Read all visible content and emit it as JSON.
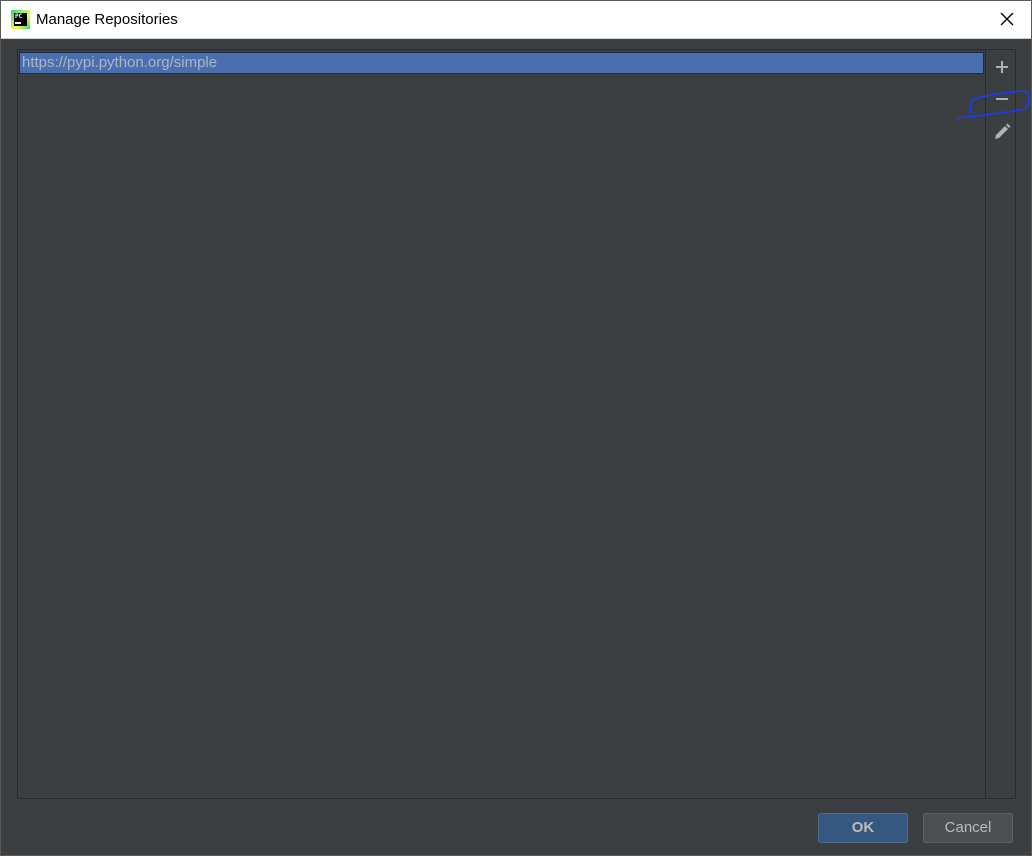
{
  "window": {
    "title": "Manage Repositories",
    "app_icon_text": "PC"
  },
  "repositories": {
    "items": [
      {
        "url": "https://pypi.python.org/simple",
        "selected": true
      }
    ]
  },
  "toolbar": {
    "add_icon": "plus-icon",
    "remove_icon": "minus-icon",
    "edit_icon": "pencil-icon"
  },
  "footer": {
    "ok_label": "OK",
    "cancel_label": "Cancel"
  },
  "colors": {
    "background": "#3c3f41",
    "selection": "#4b6eaf",
    "text": "#a9b7c6",
    "annotation": "#1a3cff",
    "ok_button": "#365880"
  }
}
